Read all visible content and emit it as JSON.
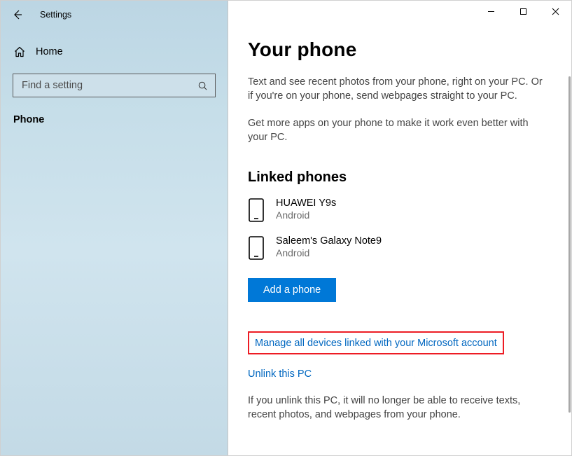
{
  "window": {
    "title": "Settings"
  },
  "sidebar": {
    "home_label": "Home",
    "search_placeholder": "Find a setting",
    "category": "Phone"
  },
  "main": {
    "title": "Your phone",
    "intro1": "Text and see recent photos from your phone, right on your PC. Or if you're on your phone, send webpages straight to your PC.",
    "intro2": "Get more apps on your phone to make it work even better with your PC.",
    "linked_title": "Linked phones",
    "phones": [
      {
        "name": "HUAWEI Y9s",
        "os": "Android"
      },
      {
        "name": "Saleem's Galaxy Note9",
        "os": "Android"
      }
    ],
    "add_button": "Add a phone",
    "manage_link": "Manage all devices linked with your Microsoft account",
    "unlink_link": "Unlink this PC",
    "unlink_desc": "If you unlink this PC, it will no longer be able to receive texts, recent photos, and webpages from your phone."
  }
}
